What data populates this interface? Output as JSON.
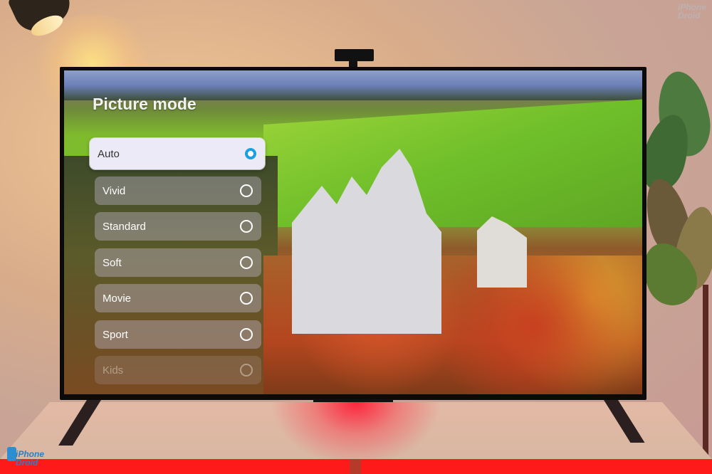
{
  "screen": {
    "menu": {
      "title": "Picture mode",
      "options": [
        {
          "label": "Auto",
          "selected": true
        },
        {
          "label": "Vivid",
          "selected": false
        },
        {
          "label": "Standard",
          "selected": false
        },
        {
          "label": "Soft",
          "selected": false
        },
        {
          "label": "Movie",
          "selected": false
        },
        {
          "label": "Sport",
          "selected": false
        },
        {
          "label": "Kids",
          "selected": false
        }
      ],
      "accent_color": "#1aa0e0"
    },
    "background_image": "Neuschwanstein castle landscape"
  },
  "watermark": {
    "line1": "iPhone",
    "line2": "Droid"
  }
}
